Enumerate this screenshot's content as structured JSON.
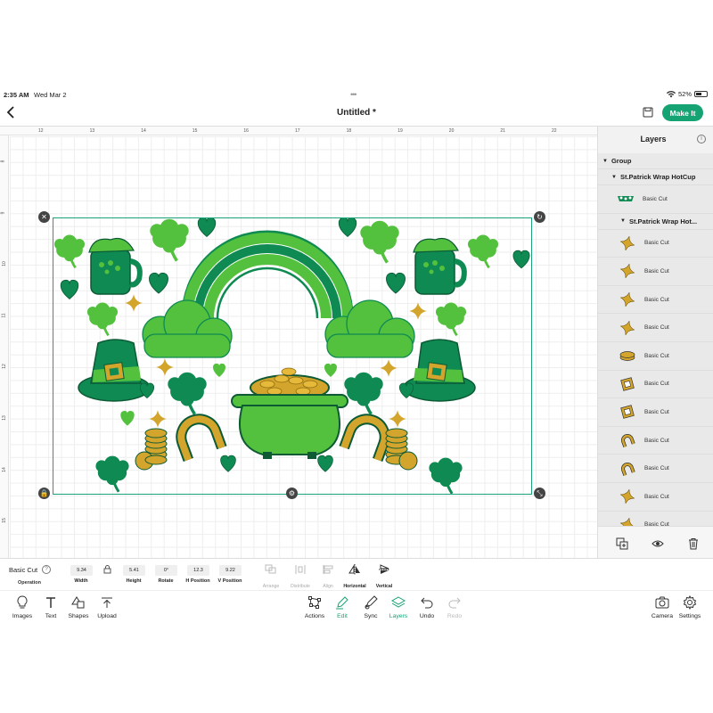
{
  "status": {
    "time": "2:35 AM",
    "date": "Wed Mar 2",
    "battery": "52%"
  },
  "header": {
    "title": "Untitled *",
    "make_it": "Make It"
  },
  "colors": {
    "accent": "#15a374",
    "selection": "#1aa37a",
    "shamrock_dark": "#0e8a52",
    "shamrock_light": "#53c13d",
    "gold": "#d4a52c"
  },
  "ruler": {
    "top": [
      "12",
      "13",
      "14",
      "15",
      "16",
      "17",
      "18",
      "19",
      "20",
      "21",
      "22"
    ],
    "left": [
      "8",
      "9",
      "10",
      "11",
      "12",
      "13",
      "14",
      "15"
    ]
  },
  "layers": {
    "title": "Layers",
    "group": "Group",
    "sub1": "St.Patrick Wrap HotCup",
    "first_item": "Basic Cut",
    "sub2": "St.Patrick Wrap Hot...",
    "items": [
      {
        "label": "Basic Cut",
        "icon": "sparkle-icon"
      },
      {
        "label": "Basic Cut",
        "icon": "sparkle-icon"
      },
      {
        "label": "Basic Cut",
        "icon": "sparkle-icon"
      },
      {
        "label": "Basic Cut",
        "icon": "sparkle-icon"
      },
      {
        "label": "Basic Cut",
        "icon": "coin-icon"
      },
      {
        "label": "Basic Cut",
        "icon": "buckle-icon"
      },
      {
        "label": "Basic Cut",
        "icon": "buckle-icon"
      },
      {
        "label": "Basic Cut",
        "icon": "horseshoe-icon"
      },
      {
        "label": "Basic Cut",
        "icon": "horseshoe-icon"
      },
      {
        "label": "Basic Cut",
        "icon": "sparkle-icon"
      },
      {
        "label": "Basic Cut",
        "icon": "sparkle-icon"
      }
    ]
  },
  "editbar": {
    "operation_value": "Basic Cut",
    "operation_label": "Operation",
    "width_value": "9.34",
    "width_label": "Width",
    "height_value": "5.41",
    "height_label": "Height",
    "rotate_value": "0°",
    "rotate_label": "Rotate",
    "hpos_value": "12.3",
    "hpos_label": "H Position",
    "vpos_value": "9.22",
    "vpos_label": "V Position",
    "arrange": "Arrange",
    "distribute": "Distribute",
    "align": "Align",
    "flip_h": "Horizontal",
    "flip_v": "Vertical"
  },
  "toolbar": {
    "images": "Images",
    "text": "Text",
    "shapes": "Shapes",
    "upload": "Upload",
    "actions": "Actions",
    "edit": "Edit",
    "sync": "Sync",
    "layers": "Layers",
    "undo": "Undo",
    "redo": "Redo",
    "camera": "Camera",
    "settings": "Settings"
  }
}
